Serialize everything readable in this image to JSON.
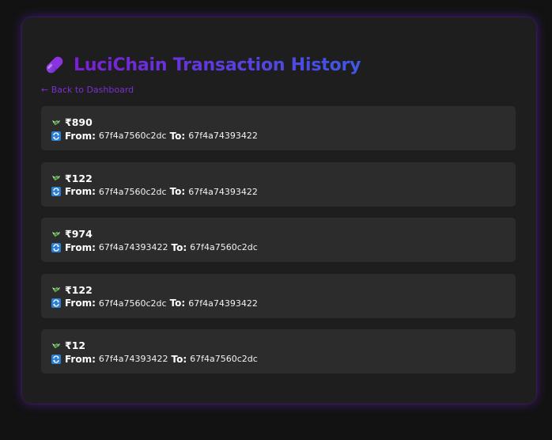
{
  "app": {
    "title": "LuciChain Transaction History",
    "back_link": "← Back to Dashboard"
  },
  "labels": {
    "from": "From:",
    "to": "To:"
  },
  "colors": {
    "background": "#121212",
    "card": "#1e1e1e",
    "row": "#2c2c2c",
    "accent_purple": "#7b2fd4",
    "title_gradient_start": "#7a1fd6",
    "title_gradient_end": "#3f57e6"
  },
  "icons": {
    "title": "pill-icon",
    "amount": "money-wings-icon",
    "direction": "repeat-arrows-icon"
  },
  "transactions": [
    {
      "amount": "₹890",
      "from": "67f4a7560c2dc",
      "to": "67f4a74393422"
    },
    {
      "amount": "₹122",
      "from": "67f4a7560c2dc",
      "to": "67f4a74393422"
    },
    {
      "amount": "₹974",
      "from": "67f4a74393422",
      "to": "67f4a7560c2dc"
    },
    {
      "amount": "₹122",
      "from": "67f4a7560c2dc",
      "to": "67f4a74393422"
    },
    {
      "amount": "₹12",
      "from": "67f4a74393422",
      "to": "67f4a7560c2dc"
    }
  ]
}
